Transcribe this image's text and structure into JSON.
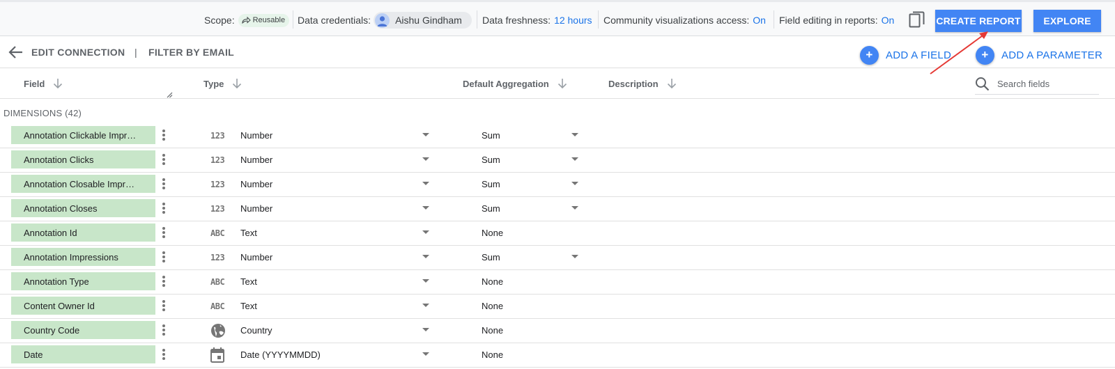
{
  "topbar": {
    "scope_label": "Scope:",
    "scope_badge": "Reusable",
    "credentials_label": "Data credentials:",
    "credentials_user": "Aishu Gindham",
    "freshness_label": "Data freshness:",
    "freshness_value": "12 hours",
    "community_label": "Community visualizations access:",
    "community_value": "On",
    "field_editing_label": "Field editing in reports:",
    "field_editing_value": "On",
    "create_report": "CREATE REPORT",
    "explore": "EXPLORE"
  },
  "subbar": {
    "edit_connection": "EDIT CONNECTION",
    "separator": "|",
    "filter_by_email": "FILTER BY EMAIL",
    "add_field": "ADD A FIELD",
    "add_parameter": "ADD A PARAMETER"
  },
  "columns": {
    "field": "Field",
    "type": "Type",
    "default_aggregation": "Default Aggregation",
    "description": "Description"
  },
  "search": {
    "placeholder": "Search fields"
  },
  "section_label": "DIMENSIONS (42)",
  "rows": [
    {
      "field": "Annotation Clickable Impr…",
      "type_icon": "123",
      "type": "Number",
      "aggregation": "Sum",
      "agg_dropdown": true
    },
    {
      "field": "Annotation Clicks",
      "type_icon": "123",
      "type": "Number",
      "aggregation": "Sum",
      "agg_dropdown": true
    },
    {
      "field": "Annotation Closable Impr…",
      "type_icon": "123",
      "type": "Number",
      "aggregation": "Sum",
      "agg_dropdown": true
    },
    {
      "field": "Annotation Closes",
      "type_icon": "123",
      "type": "Number",
      "aggregation": "Sum",
      "agg_dropdown": true
    },
    {
      "field": "Annotation Id",
      "type_icon": "ABC",
      "type": "Text",
      "aggregation": "None",
      "agg_dropdown": false
    },
    {
      "field": "Annotation Impressions",
      "type_icon": "123",
      "type": "Number",
      "aggregation": "Sum",
      "agg_dropdown": true
    },
    {
      "field": "Annotation Type",
      "type_icon": "ABC",
      "type": "Text",
      "aggregation": "None",
      "agg_dropdown": false
    },
    {
      "field": "Content Owner Id",
      "type_icon": "ABC",
      "type": "Text",
      "aggregation": "None",
      "agg_dropdown": false
    },
    {
      "field": "Country Code",
      "type_icon": "globe",
      "type": "Country",
      "aggregation": "None",
      "agg_dropdown": false
    },
    {
      "field": "Date",
      "type_icon": "calendar",
      "type": "Date (YYYYMMDD)",
      "aggregation": "None",
      "agg_dropdown": false
    }
  ],
  "colors": {
    "accent": "#4285f4",
    "link": "#1a73e8",
    "field_chip": "#c8e6c9",
    "annotation_arrow": "#e53935"
  }
}
